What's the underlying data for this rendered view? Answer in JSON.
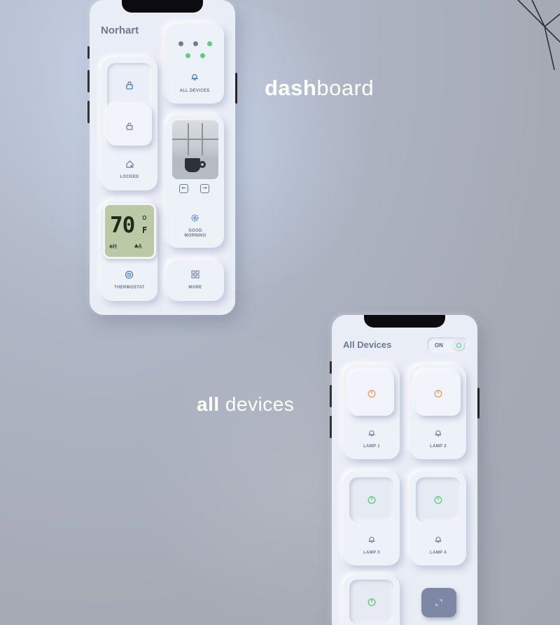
{
  "taglines": {
    "dashboard": {
      "bold": "dash",
      "light": "board"
    },
    "all_devices": {
      "bold": "all",
      "light": " devices"
    }
  },
  "dashboard": {
    "title": "Norhart",
    "all_devices_label": "ALL DEVICES",
    "locked_label": "LOCKED",
    "good_morning_label": "GOOD MORNING",
    "more_label": "MORE",
    "thermostat_label": "THERMOSTAT",
    "thermostat_display": {
      "temperature": "70",
      "unit_top": "o",
      "unit": "F",
      "left_indicator": "⊛H",
      "right_indicator": "♣A"
    },
    "status_dots": [
      "grey",
      "grey",
      "green",
      "green",
      "green"
    ],
    "icons": [
      "lock-icon",
      "unlock-icon",
      "home-icon",
      "bell-icon",
      "settings-icon",
      "grid-icon",
      "thermostat-icon",
      "arrow-left-icon",
      "arrow-right-icon"
    ]
  },
  "all_devices": {
    "title": "All Devices",
    "toggle_label": "ON",
    "lamps": [
      {
        "label": "LAMP 1",
        "state": "on",
        "power_color": "#f0a060"
      },
      {
        "label": "LAMP 2",
        "state": "on",
        "power_color": "#f0a060"
      },
      {
        "label": "LAMP 3",
        "state": "off",
        "power_color": "#5fcf7e"
      },
      {
        "label": "LAMP 4",
        "state": "off",
        "power_color": "#5fcf7e"
      }
    ],
    "colors": {
      "accent_orange": "#f0a060",
      "accent_green": "#5fcf7e",
      "dark_tile": "#7e88a4"
    }
  }
}
